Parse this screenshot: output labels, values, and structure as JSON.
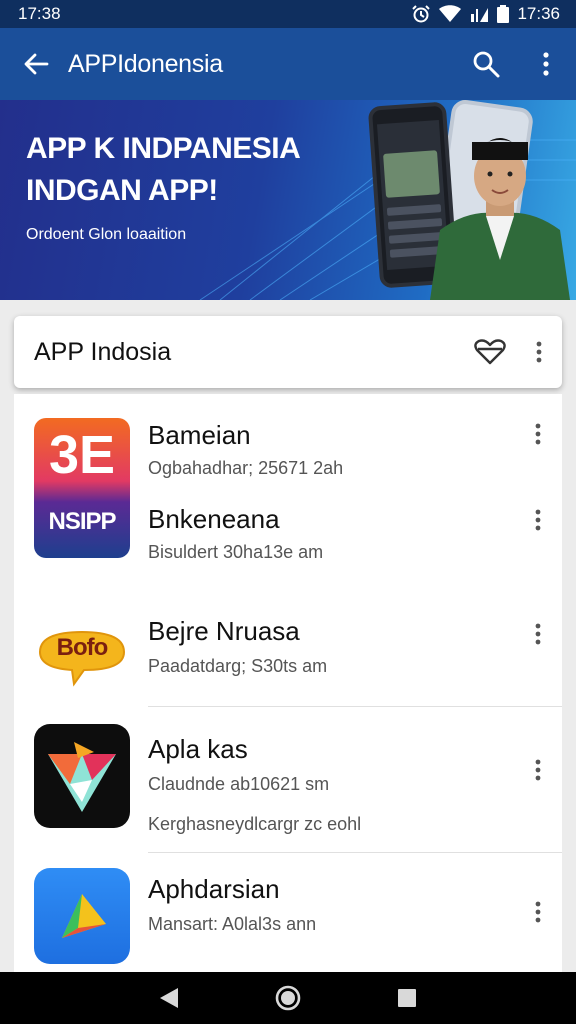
{
  "status_bar": {
    "time_left": "17:38",
    "time_right": "17:36",
    "icons": [
      "alarm-icon",
      "wifi-icon",
      "signal-icon",
      "signal-icon",
      "battery-icon"
    ]
  },
  "app_bar": {
    "title": "APPIdonensia",
    "back_icon": "arrow-back-icon",
    "search_icon": "search-icon",
    "more_icon": "more-vert-icon"
  },
  "banner": {
    "headline_line1": "APP K INDPANESIA",
    "headline_line2": "INDGAN APP!",
    "subtitle": "Ordoent Glon loaaition"
  },
  "search_card": {
    "label": "APP  Indosia",
    "heart_icon": "heart-icon",
    "more_icon": "more-vert-icon"
  },
  "apps": [
    {
      "title": "Bameian",
      "subtitle": "Ogbahadhar; 25671 2ah",
      "icon": "app-icon-3e"
    },
    {
      "title": "Bnkeneana",
      "subtitle": "Bisuldert 30ha13e am",
      "icon": "app-icon-nsipp"
    },
    {
      "title": "Bejre Nruasa",
      "subtitle": "Paadatdarg; S30ts am",
      "icon": "app-icon-bofo"
    },
    {
      "title": "Apla kas",
      "subtitle": "Claudnde ab10621 sm",
      "extra": "Kerghasneydlcargr zc eohl",
      "icon": "app-icon-triangle"
    },
    {
      "title": "Aphdarsian",
      "subtitle": "Mansart: A0lal3s ann",
      "icon": "app-icon-play"
    }
  ],
  "icon_texts": {
    "icon1_big": "3E",
    "icon1_small": "NSIPP",
    "icon3": "Bofo"
  },
  "nav": {
    "back": "nav-back-icon",
    "home": "nav-home-icon",
    "recents": "nav-recents-icon"
  },
  "colors": {
    "status_bar": "#0f2f5f",
    "app_bar": "#1b4f9a",
    "banner_start": "#232f8c",
    "banner_end": "#38a9e4"
  }
}
